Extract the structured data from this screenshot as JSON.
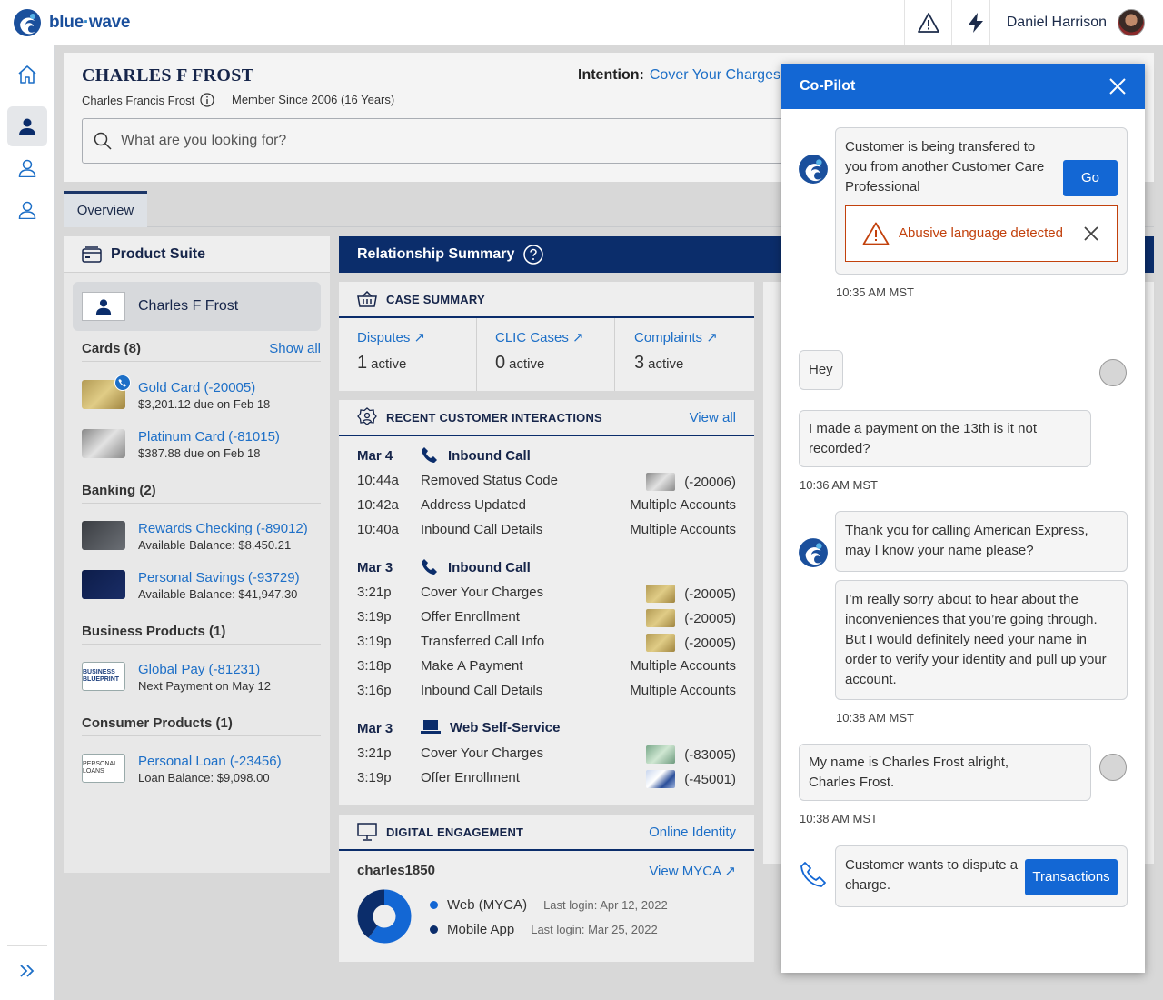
{
  "brand": {
    "name_a": "blue",
    "name_b": "wave"
  },
  "topbar": {
    "user_name": "Daniel Harrison"
  },
  "customer": {
    "name": "CHARLES F FROST",
    "full_name": "Charles Francis Frost",
    "member_since": "Member Since 2006 (16 Years)",
    "intention_label": "Intention:",
    "intention_value": "Cover Your Charges"
  },
  "search": {
    "placeholder": "What are you looking for?"
  },
  "tabs": [
    {
      "label": "Overview"
    }
  ],
  "product_suite": {
    "title": "Product Suite",
    "customer": "Charles F Frost",
    "cards": {
      "title": "Cards (8)",
      "link": "Show all",
      "items": [
        {
          "name": "Gold Card (-20005)",
          "sub": "$3,201.12 due on Feb 18"
        },
        {
          "name": "Platinum Card (-81015)",
          "sub": "$387.88 due on Feb 18"
        }
      ]
    },
    "banking": {
      "title": "Banking (2)",
      "items": [
        {
          "name": "Rewards Checking (-89012)",
          "sub": "Available Balance: $8,450.21"
        },
        {
          "name": "Personal Savings (-93729)",
          "sub": "Available Balance: $41,947.30"
        }
      ]
    },
    "business": {
      "title": "Business Products (1)",
      "items": [
        {
          "name": "Global Pay (-81231)",
          "sub": "Next Payment on May 12",
          "logo": "BUSINESS BLUEPRINT"
        }
      ]
    },
    "consumer": {
      "title": "Consumer Products (1)",
      "items": [
        {
          "name": "Personal Loan (-23456)",
          "sub": "Loan Balance: $9,098.00",
          "logo": "PERSONAL LOANS"
        }
      ]
    }
  },
  "relationship": {
    "title": "Relationship Summary"
  },
  "case_summary": {
    "title": "CASE SUMMARY",
    "cells": [
      {
        "label": "Disputes",
        "count": "1",
        "status": "active"
      },
      {
        "label": "CLIC Cases",
        "count": "0",
        "status": "active"
      },
      {
        "label": "Complaints",
        "count": "3",
        "status": "active"
      }
    ]
  },
  "interactions": {
    "title": "RECENT CUSTOMER INTERACTIONS",
    "link": "View all",
    "groups": [
      {
        "date": "Mar 4",
        "type": "Inbound Call",
        "rows": [
          {
            "time": "10:44a",
            "desc": "Removed Status Code",
            "acct": "(-20006)"
          },
          {
            "time": "10:42a",
            "desc": "Address Updated",
            "acct": "Multiple Accounts"
          },
          {
            "time": "10:40a",
            "desc": "Inbound Call Details",
            "acct": "Multiple Accounts"
          }
        ]
      },
      {
        "date": "Mar 3",
        "type": "Inbound Call",
        "rows": [
          {
            "time": "3:21p",
            "desc": "Cover Your Charges",
            "acct": "(-20005)"
          },
          {
            "time": "3:19p",
            "desc": "Offer Enrollment",
            "acct": "(-20005)"
          },
          {
            "time": "3:19p",
            "desc": "Transferred Call Info",
            "acct": "(-20005)"
          },
          {
            "time": "3:18p",
            "desc": "Make A Payment",
            "acct": "Multiple Accounts"
          },
          {
            "time": "3:16p",
            "desc": "Inbound Call Details",
            "acct": "Multiple Accounts"
          }
        ]
      },
      {
        "date": "Mar 3",
        "type": "Web Self-Service",
        "rows": [
          {
            "time": "3:21p",
            "desc": "Cover Your Charges",
            "acct": "(-83005)"
          },
          {
            "time": "3:19p",
            "desc": "Offer Enrollment",
            "acct": "(-45001)"
          }
        ]
      }
    ]
  },
  "digital": {
    "title": "DIGITAL ENGAGEMENT",
    "link": "Online Identity",
    "username": "charles1850",
    "view_link": "View MYCA",
    "channels": [
      {
        "name": "Web (MYCA)",
        "last": "Last login: Apr 12, 2022",
        "color": "#1367d4",
        "share": 0.6
      },
      {
        "name": "Mobile App",
        "last": "Last login: Mar 25, 2022",
        "color": "#0b2d6b",
        "share": 0.4
      }
    ]
  },
  "copilot": {
    "title": "Co-Pilot",
    "m1": "Customer is being transfered to you from another Customer Care Professional",
    "go": "Go",
    "alert": "Abusive language detected",
    "t1": "10:35 AM MST",
    "c1": "Hey",
    "c2": "I made a payment on the 13th is it not recorded?",
    "t2": "10:36 AM MST",
    "m2": "Thank you for calling American Express, may I know your name please?",
    "m3": "I’m really sorry about to hear about the inconveniences that you’re going through. But I would definitely need your name in order to verify your identity and pull up your account.",
    "t3": "10:38 AM MST",
    "c3": "My name is Charles Frost alright, Charles Frost.",
    "t4": "10:38 AM MST",
    "m4": "Customer wants to dispute a charge.",
    "transactions": "Transactions"
  }
}
